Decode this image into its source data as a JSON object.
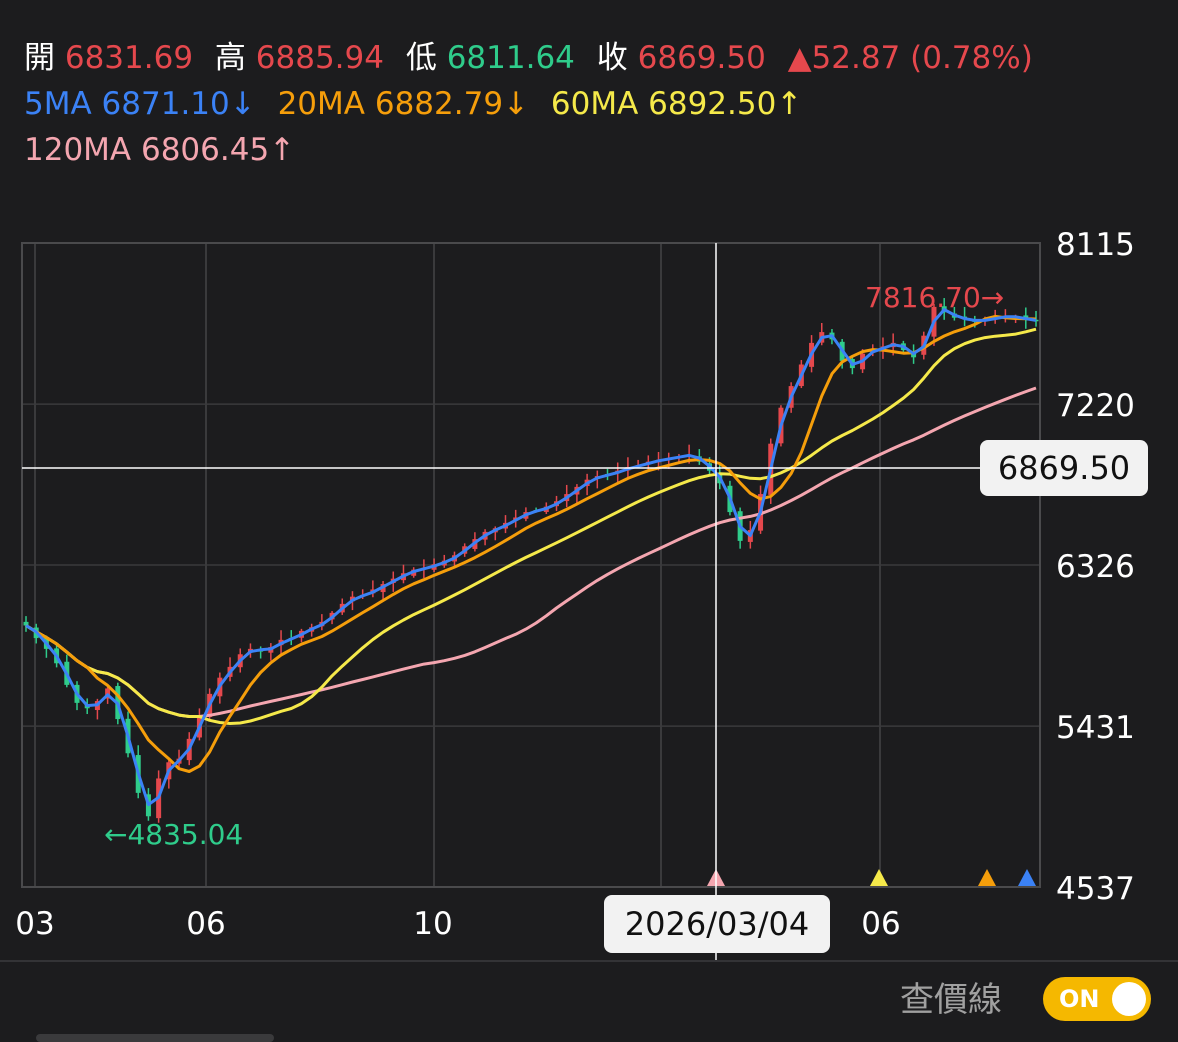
{
  "ohlc": {
    "open_label": "開",
    "open_value": "6831.69",
    "high_label": "高",
    "high_value": "6885.94",
    "low_label": "低",
    "low_value": "6811.64",
    "close_label": "收",
    "close_value": "6869.50",
    "change": "▲52.87",
    "change_pct": "(0.78%)"
  },
  "ma": {
    "ma5_label": "5MA",
    "ma5_value": "6871.10↓",
    "ma20_label": "20MA",
    "ma20_value": "6882.79↓",
    "ma60_label": "60MA",
    "ma60_value": "6892.50↑",
    "ma120_label": "120MA",
    "ma120_value": "6806.45↑"
  },
  "crosshair": {
    "price": "6869.50",
    "date": "2026/03/04"
  },
  "annotations": {
    "max": "7816.70→",
    "min": "←4835.04"
  },
  "footer": {
    "label": "查價線",
    "toggle": "ON"
  },
  "colors": {
    "up": "#e5484d",
    "down": "#2fcc8b",
    "ma5": "#3b82f6",
    "ma20": "#f59e0b",
    "ma60": "#f5e94a",
    "ma120": "#f4a6b0"
  },
  "chart_data": {
    "type": "candlestick",
    "x_tick_labels": [
      "03",
      "06",
      "10",
      "06"
    ],
    "y_tick_labels": [
      "8115",
      "7220",
      "6326",
      "5431",
      "4537"
    ],
    "ylim": [
      4537,
      8115
    ],
    "grid": true,
    "close_series": [
      5990,
      5920,
      5860,
      5780,
      5660,
      5560,
      5530,
      5570,
      5640,
      5470,
      5280,
      5060,
      4930,
      5140,
      5230,
      5250,
      5360,
      5490,
      5610,
      5700,
      5760,
      5830,
      5860,
      5850,
      5870,
      5910,
      5920,
      5960,
      5980,
      6010,
      6060,
      6110,
      6150,
      6160,
      6190,
      6220,
      6250,
      6280,
      6300,
      6310,
      6330,
      6350,
      6380,
      6430,
      6470,
      6510,
      6530,
      6560,
      6590,
      6620,
      6630,
      6650,
      6680,
      6720,
      6760,
      6800,
      6820,
      6830,
      6850,
      6870,
      6880,
      6900,
      6910,
      6920,
      6930,
      6940,
      6900,
      6850,
      6780,
      6620,
      6460,
      6520,
      6720,
      7000,
      7200,
      7320,
      7440,
      7560,
      7620,
      7580,
      7460,
      7420,
      7500,
      7520,
      7540,
      7560,
      7520,
      7480,
      7600,
      7760,
      7730,
      7700,
      7690,
      7680,
      7690,
      7700,
      7710,
      7700,
      7690,
      7680
    ],
    "markers": [
      "pink",
      "yellow",
      "orange",
      "blue"
    ]
  }
}
